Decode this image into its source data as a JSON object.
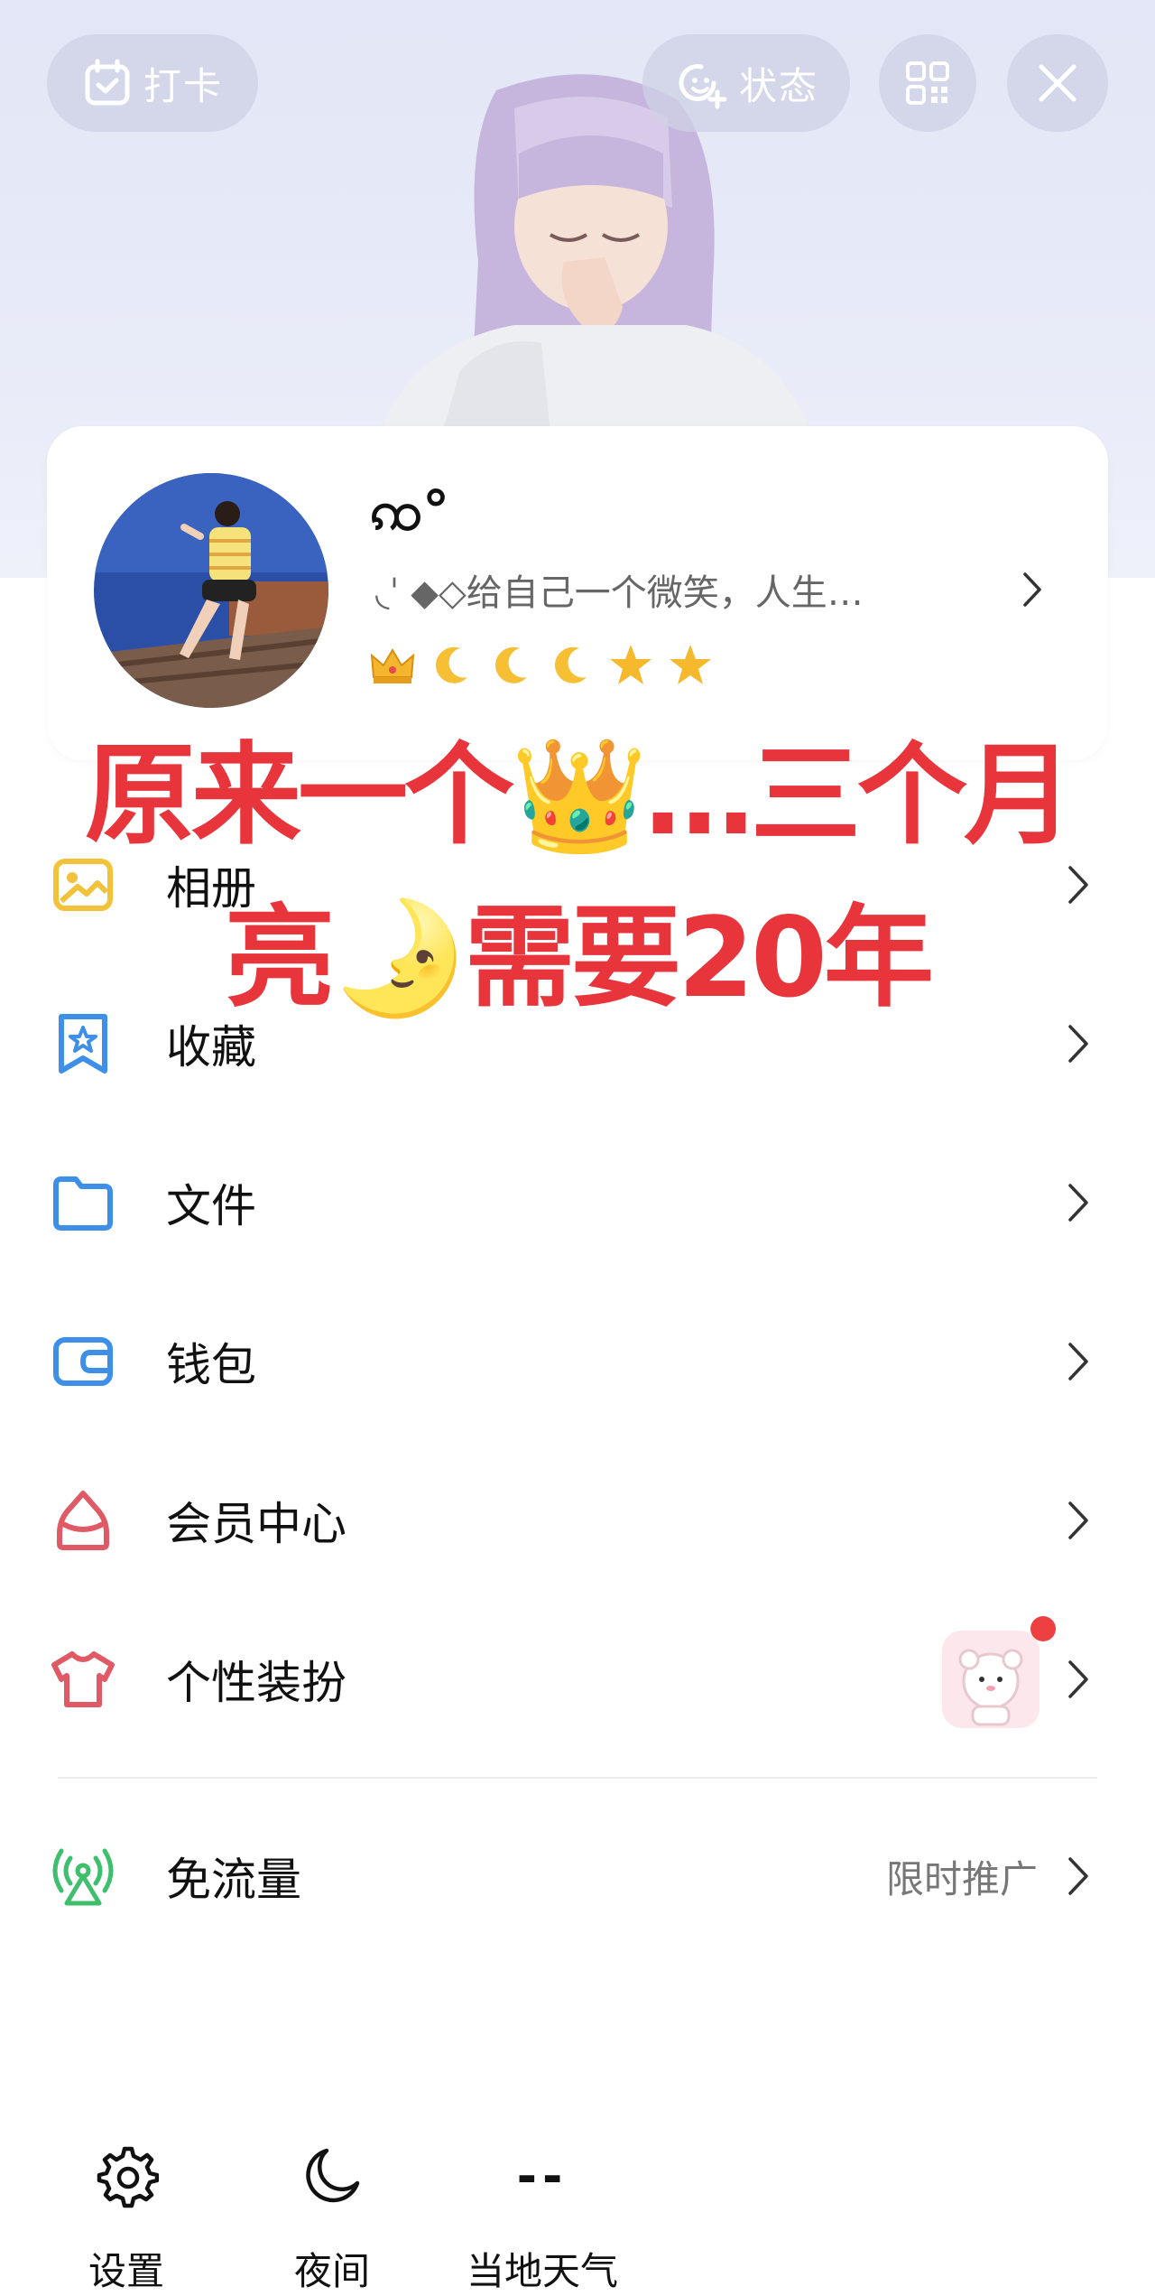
{
  "header": {
    "checkin_label": "打卡",
    "status_label": "状态"
  },
  "profile": {
    "nickname": "ꩡ°",
    "signature": "◟ˈ ◆◇给自己一个微笑，人生…",
    "badges": [
      "crown-icon",
      "moon-icon",
      "moon-icon",
      "moon-icon",
      "star-icon",
      "star-icon"
    ]
  },
  "overlay_caption": {
    "line1": "原来一个👑…三个月",
    "line2": "亮🌛需要20年"
  },
  "menu": {
    "items": [
      {
        "label": "相册",
        "icon": "photo-icon"
      },
      {
        "label": "收藏",
        "icon": "bookmark-star-icon"
      },
      {
        "label": "文件",
        "icon": "folder-icon"
      },
      {
        "label": "钱包",
        "icon": "wallet-icon"
      },
      {
        "label": "会员中心",
        "icon": "vip-icon"
      },
      {
        "label": "个性装扮",
        "icon": "tshirt-icon"
      },
      {
        "label": "免流量",
        "icon": "signal-tower-icon",
        "extra": "限时推广"
      }
    ]
  },
  "bottom": {
    "settings_label": "设置",
    "night_label": "夜间",
    "weather_value": "--",
    "weather_label": "当地天气"
  },
  "colors": {
    "caption_red": "#e8353c",
    "icon_yellow": "#f2c23a",
    "icon_blue": "#3d8fe8",
    "icon_red": "#e05a66",
    "icon_green": "#3fbf6e"
  }
}
